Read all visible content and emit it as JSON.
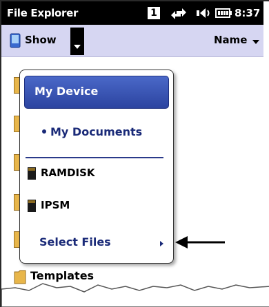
{
  "titlebar": {
    "app_title": "File Explorer",
    "badge": "1",
    "time": "8:37",
    "icons": [
      "signal-arrows-icon",
      "speaker-icon",
      "battery-icon"
    ]
  },
  "toolbar": {
    "show_label": "Show",
    "sort_label": "Name"
  },
  "popup_menu": {
    "selected_item": "My Device",
    "items": [
      {
        "label": "My Documents",
        "bullet": true
      },
      {
        "label": "RAMDISK",
        "icon": "storage-card-icon"
      },
      {
        "label": "IPSM",
        "icon": "storage-card-icon"
      },
      {
        "label": "Select Files",
        "submenu": true
      }
    ]
  },
  "background_list": {
    "visible_item": "Templates"
  },
  "colors": {
    "titlebar_bg": "#000000",
    "toolbar_bg": "#d6d6f2",
    "menu_highlight": "#3550b4",
    "menu_text": "#1a2a78",
    "folder": "#e8b64a"
  }
}
